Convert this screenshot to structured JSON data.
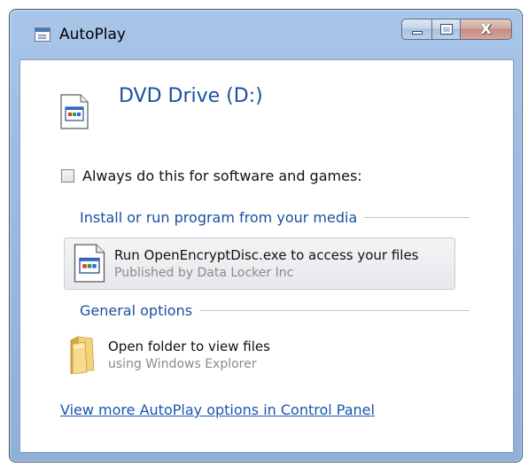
{
  "window": {
    "title": "AutoPlay",
    "title_icon": "window-icon",
    "buttons": {
      "minimize_icon": "minimize-icon",
      "maximize_icon": "maximize-icon",
      "close_label": "X"
    }
  },
  "device": {
    "name": "DVD Drive (D:)",
    "icon": "program-window-icon"
  },
  "always": {
    "label": "Always do this for software and games:",
    "checked": false
  },
  "sections": [
    {
      "header": "Install or run program from your media",
      "options": [
        {
          "title": "Run OpenEncryptDisc.exe to access your files",
          "subtitle": "Published by Data Locker Inc",
          "icon": "program-window-icon",
          "selected": true
        }
      ]
    },
    {
      "header": "General options",
      "options": [
        {
          "title": "Open folder to view files",
          "subtitle": "using Windows Explorer",
          "icon": "folder-icon",
          "selected": false
        }
      ]
    }
  ],
  "footer_link": "View more AutoPlay options in Control Panel",
  "colors": {
    "frame": "#9cbde3",
    "accent_text": "#1a4fa0",
    "link": "#1a55b0",
    "subtext": "#8a8a8a"
  }
}
